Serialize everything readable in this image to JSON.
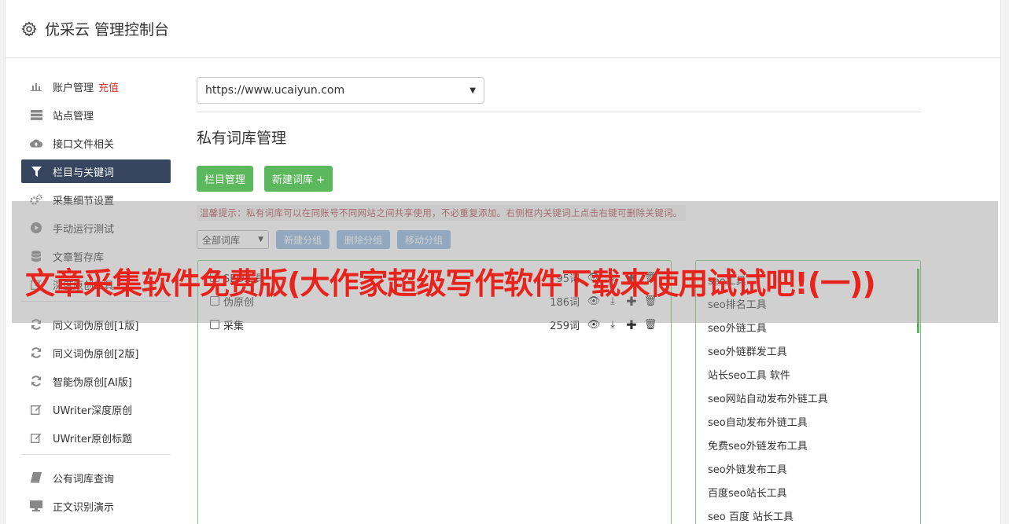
{
  "header": {
    "title": "优采云 管理控制台",
    "icon": "gear-icon"
  },
  "sidebar": {
    "items": [
      {
        "label": "账户管理",
        "extra": "充值",
        "icon": "bar-chart-icon"
      },
      {
        "label": "站点管理",
        "icon": "server-icon"
      },
      {
        "label": "接口文件相关",
        "icon": "cloud-upload-icon"
      },
      {
        "label": "栏目与关键词",
        "icon": "filter-icon",
        "active": true
      },
      {
        "label": "采集细节设置",
        "icon": "cogs-icon"
      },
      {
        "label": "手动运行测试",
        "icon": "play-circle-icon"
      },
      {
        "label": "文章暂存库",
        "icon": "database-icon"
      },
      {
        "label": "深度原创工具",
        "icon": "edit-icon"
      },
      {
        "label": "同义词伪原创[1版]",
        "icon": "refresh-icon"
      },
      {
        "label": "同义词伪原创[2版]",
        "icon": "refresh-icon"
      },
      {
        "label": "智能伪原创[AI版]",
        "icon": "refresh-icon"
      },
      {
        "label": "UWriter深度原创",
        "icon": "edit-icon"
      },
      {
        "label": "UWriter原创标题",
        "icon": "edit-icon"
      },
      {
        "label": "公有词库查询",
        "icon": "book-icon"
      },
      {
        "label": "正文识别演示",
        "icon": "monitor-icon"
      }
    ]
  },
  "main": {
    "site_select": "https://www.ucaiyun.com",
    "section_title": "私有词库管理",
    "buttons": {
      "category_manage": "栏目管理",
      "new_library": "新建词库 +"
    },
    "tip": "温馨提示：私有词库可以在同账号不同网站之间共享使用，不必重复添加。右侧框内关键词上点击右键可删除关键词。",
    "filter_select": "全部词库",
    "group_buttons": {
      "new_group": "新建分组",
      "delete_group": "删除分组",
      "move_group": "移动分组"
    },
    "libraries": [
      {
        "name": "SEO工具",
        "count": "95词"
      },
      {
        "name": "伪原创",
        "count": "186词"
      },
      {
        "name": "采集",
        "count": "259词"
      }
    ],
    "keywords": [
      "seo工具",
      "seo排名工具",
      "seo外链工具",
      "seo外链群发工具",
      "站长seo工具 软件",
      "seo网站自动发布外链工具",
      "seo自动发布外链工具",
      "免费seo外链发布工具",
      "seo外链发布工具",
      "百度seo站长工具",
      "seo 百度 站长工具"
    ]
  },
  "overlay": {
    "title": "文章采集软件免费版(大作家超级写作软件下载来使用试试吧!(一))"
  },
  "colors": {
    "active_nav": "#37465e",
    "green": "#5cb85c",
    "blue": "#8eb6e0",
    "overlay_text": "#e8231c"
  }
}
